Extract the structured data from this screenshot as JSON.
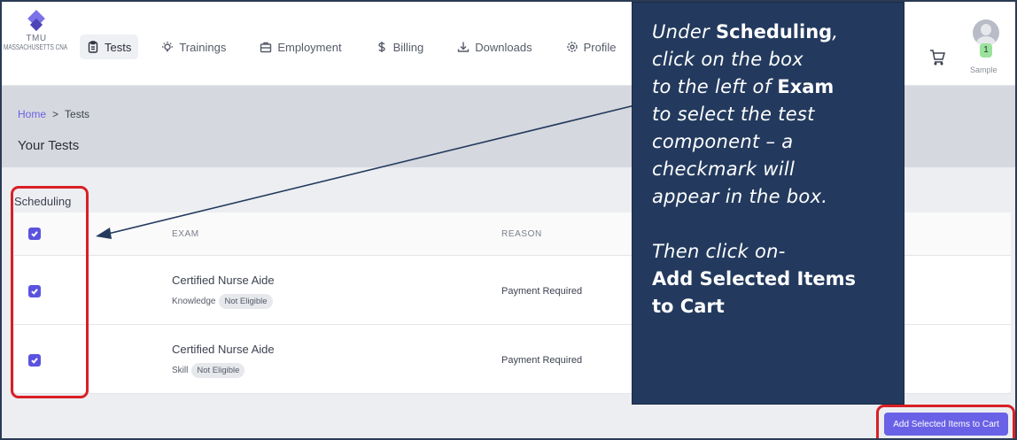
{
  "logo": {
    "name": "TMU",
    "subtitle": "MASSACHUSETTS CNA"
  },
  "nav": {
    "items": [
      {
        "label": "Tests",
        "icon": "clipboard-icon",
        "active": true
      },
      {
        "label": "Trainings",
        "icon": "lightbulb-icon",
        "active": false
      },
      {
        "label": "Employment",
        "icon": "briefcase-icon",
        "active": false
      },
      {
        "label": "Billing",
        "icon": "dollar-icon",
        "active": false
      },
      {
        "label": "Downloads",
        "icon": "download-icon",
        "active": false
      },
      {
        "label": "Profile",
        "icon": "gear-icon",
        "active": false
      }
    ]
  },
  "user": {
    "name": "Sample",
    "cart_count": "1"
  },
  "breadcrumb": {
    "home": "Home",
    "separator": ">",
    "current": "Tests"
  },
  "page_title": "Your Tests",
  "section": {
    "label": "Scheduling"
  },
  "table": {
    "headers": {
      "exam": "EXAM",
      "reason": "REASON"
    },
    "rows": [
      {
        "name": "Certified Nurse Aide",
        "type": "Knowledge",
        "status": "Not Eligible",
        "reason": "Payment Required",
        "checked": true
      },
      {
        "name": "Certified Nurse Aide",
        "type": "Skill",
        "status": "Not Eligible",
        "reason": "Payment Required",
        "checked": true
      }
    ]
  },
  "add_button": {
    "label": "Add Selected Items to Cart"
  },
  "callout": {
    "line1_a": "Under ",
    "line1_b": "Scheduling",
    "line2": "click on the box",
    "line3_a": "to the left of ",
    "line3_b": "Exam",
    "line4": "to select the test",
    "line5": "component – a",
    "line6": "checkmark will",
    "line7": "appear in the box.",
    "line8": "Then click on-",
    "line9": "Add Selected Items",
    "line10": "to Cart"
  },
  "colors": {
    "accent": "#6961e6",
    "callout_bg": "#233a5e",
    "annotation_red": "#d91f26"
  }
}
